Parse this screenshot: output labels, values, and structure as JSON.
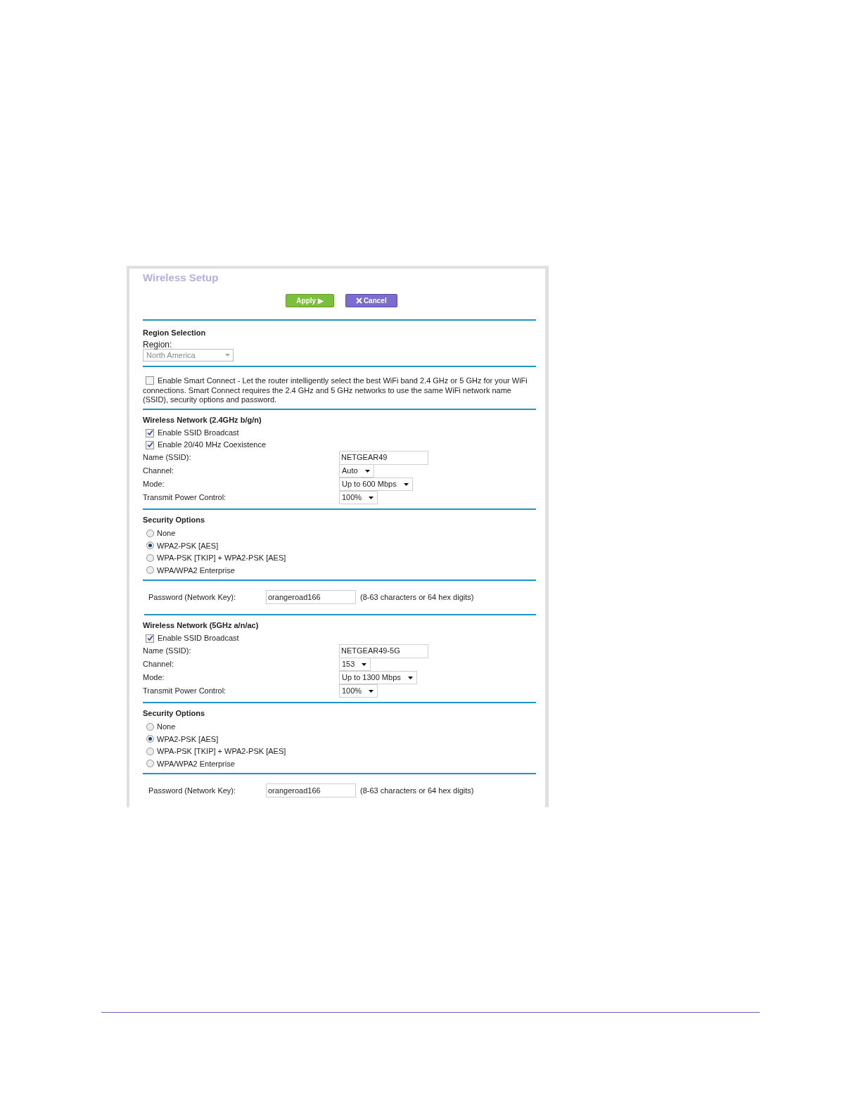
{
  "page": {
    "title": "Wireless Setup",
    "buttons": [
      {
        "kind": "apply",
        "label": "Apply ▶"
      },
      {
        "kind": "cancel",
        "label": "Cancel"
      }
    ],
    "region": {
      "heading": "Region Selection",
      "label": "Region:",
      "value": "North America"
    },
    "smart_connect": {
      "checked": false,
      "text": "Enable Smart Connect - Let the router intelligently select the best WiFi band 2.4 GHz or 5 GHz for your WiFi connections. Smart Connect requires the 2.4 GHz and 5 GHz networks to use the same WiFi network name (SSID), security options and password."
    },
    "networks": [
      {
        "heading": "Wireless Network (2.4GHz b/g/n)",
        "checkboxes": [
          {
            "label": "Enable SSID Broadcast",
            "checked": true
          },
          {
            "label": "Enable 20/40 MHz Coexistence",
            "checked": true
          }
        ],
        "fields": [
          {
            "kind": "text",
            "label": "Name (SSID):",
            "value": "NETGEAR49"
          },
          {
            "kind": "select",
            "label": "Channel:",
            "value": "Auto"
          },
          {
            "kind": "select",
            "label": "Mode:",
            "value": "Up to 600 Mbps"
          },
          {
            "kind": "select",
            "label": "Transmit Power Control:",
            "value": "100%"
          }
        ],
        "security": {
          "heading": "Security Options",
          "options": [
            {
              "label": "None",
              "selected": false
            },
            {
              "label": "WPA2-PSK [AES]",
              "selected": true
            },
            {
              "label": "WPA-PSK [TKIP] + WPA2-PSK [AES]",
              "selected": false
            },
            {
              "label": "WPA/WPA2 Enterprise",
              "selected": false
            }
          ]
        },
        "password": {
          "label": "Password (Network Key):",
          "value": "orangeroad166",
          "hint": "(8-63 characters or 64 hex digits)"
        }
      },
      {
        "heading": "Wireless Network (5GHz a/n/ac)",
        "checkboxes": [
          {
            "label": "Enable SSID Broadcast",
            "checked": true
          }
        ],
        "fields": [
          {
            "kind": "text",
            "label": "Name (SSID):",
            "value": "NETGEAR49-5G"
          },
          {
            "kind": "select",
            "label": "Channel:",
            "value": "153"
          },
          {
            "kind": "select",
            "label": "Mode:",
            "value": "Up to 1300 Mbps"
          },
          {
            "kind": "select",
            "label": "Transmit Power Control:",
            "value": "100%"
          }
        ],
        "security": {
          "heading": "Security Options",
          "options": [
            {
              "label": "None",
              "selected": false
            },
            {
              "label": "WPA2-PSK [AES]",
              "selected": true
            },
            {
              "label": "WPA-PSK [TKIP] + WPA2-PSK [AES]",
              "selected": false
            },
            {
              "label": "WPA/WPA2 Enterprise",
              "selected": false
            }
          ]
        },
        "password": {
          "label": "Password (Network Key):",
          "value": "orangeroad166",
          "hint": "(8-63 characters or 64 hex digits)"
        }
      }
    ]
  }
}
